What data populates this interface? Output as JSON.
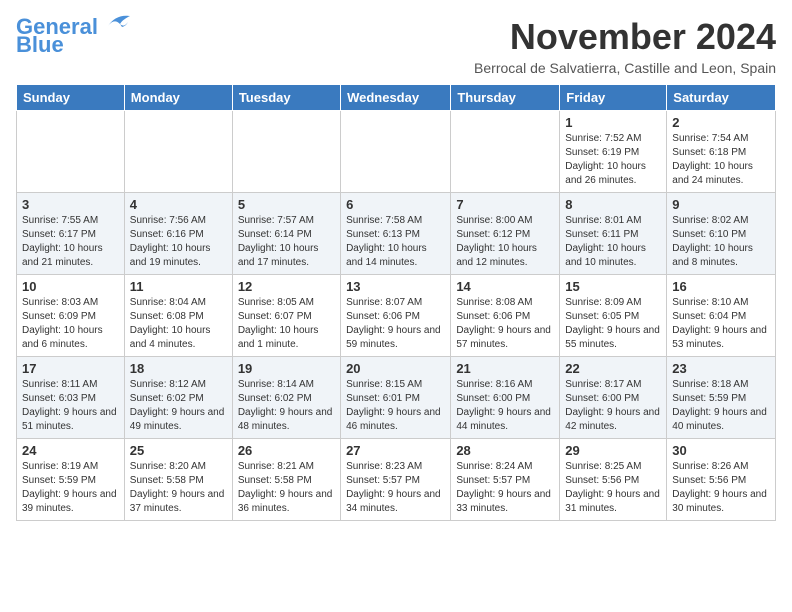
{
  "header": {
    "logo_line1": "General",
    "logo_line2": "Blue",
    "month_title": "November 2024",
    "subtitle": "Berrocal de Salvatierra, Castille and Leon, Spain"
  },
  "weekdays": [
    "Sunday",
    "Monday",
    "Tuesday",
    "Wednesday",
    "Thursday",
    "Friday",
    "Saturday"
  ],
  "weeks": [
    [
      {
        "day": "",
        "text": ""
      },
      {
        "day": "",
        "text": ""
      },
      {
        "day": "",
        "text": ""
      },
      {
        "day": "",
        "text": ""
      },
      {
        "day": "",
        "text": ""
      },
      {
        "day": "1",
        "text": "Sunrise: 7:52 AM\nSunset: 6:19 PM\nDaylight: 10 hours and 26 minutes."
      },
      {
        "day": "2",
        "text": "Sunrise: 7:54 AM\nSunset: 6:18 PM\nDaylight: 10 hours and 24 minutes."
      }
    ],
    [
      {
        "day": "3",
        "text": "Sunrise: 7:55 AM\nSunset: 6:17 PM\nDaylight: 10 hours and 21 minutes."
      },
      {
        "day": "4",
        "text": "Sunrise: 7:56 AM\nSunset: 6:16 PM\nDaylight: 10 hours and 19 minutes."
      },
      {
        "day": "5",
        "text": "Sunrise: 7:57 AM\nSunset: 6:14 PM\nDaylight: 10 hours and 17 minutes."
      },
      {
        "day": "6",
        "text": "Sunrise: 7:58 AM\nSunset: 6:13 PM\nDaylight: 10 hours and 14 minutes."
      },
      {
        "day": "7",
        "text": "Sunrise: 8:00 AM\nSunset: 6:12 PM\nDaylight: 10 hours and 12 minutes."
      },
      {
        "day": "8",
        "text": "Sunrise: 8:01 AM\nSunset: 6:11 PM\nDaylight: 10 hours and 10 minutes."
      },
      {
        "day": "9",
        "text": "Sunrise: 8:02 AM\nSunset: 6:10 PM\nDaylight: 10 hours and 8 minutes."
      }
    ],
    [
      {
        "day": "10",
        "text": "Sunrise: 8:03 AM\nSunset: 6:09 PM\nDaylight: 10 hours and 6 minutes."
      },
      {
        "day": "11",
        "text": "Sunrise: 8:04 AM\nSunset: 6:08 PM\nDaylight: 10 hours and 4 minutes."
      },
      {
        "day": "12",
        "text": "Sunrise: 8:05 AM\nSunset: 6:07 PM\nDaylight: 10 hours and 1 minute."
      },
      {
        "day": "13",
        "text": "Sunrise: 8:07 AM\nSunset: 6:06 PM\nDaylight: 9 hours and 59 minutes."
      },
      {
        "day": "14",
        "text": "Sunrise: 8:08 AM\nSunset: 6:06 PM\nDaylight: 9 hours and 57 minutes."
      },
      {
        "day": "15",
        "text": "Sunrise: 8:09 AM\nSunset: 6:05 PM\nDaylight: 9 hours and 55 minutes."
      },
      {
        "day": "16",
        "text": "Sunrise: 8:10 AM\nSunset: 6:04 PM\nDaylight: 9 hours and 53 minutes."
      }
    ],
    [
      {
        "day": "17",
        "text": "Sunrise: 8:11 AM\nSunset: 6:03 PM\nDaylight: 9 hours and 51 minutes."
      },
      {
        "day": "18",
        "text": "Sunrise: 8:12 AM\nSunset: 6:02 PM\nDaylight: 9 hours and 49 minutes."
      },
      {
        "day": "19",
        "text": "Sunrise: 8:14 AM\nSunset: 6:02 PM\nDaylight: 9 hours and 48 minutes."
      },
      {
        "day": "20",
        "text": "Sunrise: 8:15 AM\nSunset: 6:01 PM\nDaylight: 9 hours and 46 minutes."
      },
      {
        "day": "21",
        "text": "Sunrise: 8:16 AM\nSunset: 6:00 PM\nDaylight: 9 hours and 44 minutes."
      },
      {
        "day": "22",
        "text": "Sunrise: 8:17 AM\nSunset: 6:00 PM\nDaylight: 9 hours and 42 minutes."
      },
      {
        "day": "23",
        "text": "Sunrise: 8:18 AM\nSunset: 5:59 PM\nDaylight: 9 hours and 40 minutes."
      }
    ],
    [
      {
        "day": "24",
        "text": "Sunrise: 8:19 AM\nSunset: 5:59 PM\nDaylight: 9 hours and 39 minutes."
      },
      {
        "day": "25",
        "text": "Sunrise: 8:20 AM\nSunset: 5:58 PM\nDaylight: 9 hours and 37 minutes."
      },
      {
        "day": "26",
        "text": "Sunrise: 8:21 AM\nSunset: 5:58 PM\nDaylight: 9 hours and 36 minutes."
      },
      {
        "day": "27",
        "text": "Sunrise: 8:23 AM\nSunset: 5:57 PM\nDaylight: 9 hours and 34 minutes."
      },
      {
        "day": "28",
        "text": "Sunrise: 8:24 AM\nSunset: 5:57 PM\nDaylight: 9 hours and 33 minutes."
      },
      {
        "day": "29",
        "text": "Sunrise: 8:25 AM\nSunset: 5:56 PM\nDaylight: 9 hours and 31 minutes."
      },
      {
        "day": "30",
        "text": "Sunrise: 8:26 AM\nSunset: 5:56 PM\nDaylight: 9 hours and 30 minutes."
      }
    ]
  ]
}
